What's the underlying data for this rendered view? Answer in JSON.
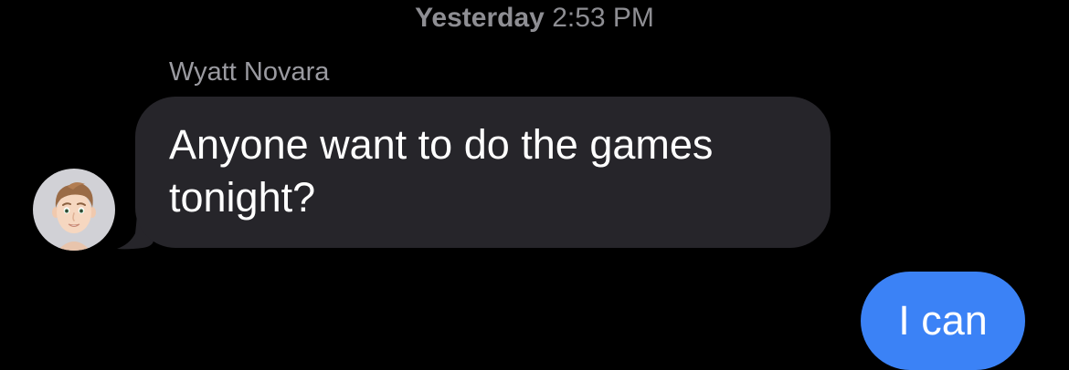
{
  "conversation": {
    "timestamp": {
      "day": "Yesterday",
      "time": "2:53 PM"
    },
    "messages": [
      {
        "direction": "incoming",
        "sender": "Wyatt Novara",
        "avatar_icon": "memoji-avatar-icon",
        "text": "Anyone want to do the games tonight?"
      },
      {
        "direction": "outgoing",
        "text": "I can"
      }
    ]
  },
  "colors": {
    "background": "#000000",
    "incoming_bubble": "#26252a",
    "outgoing_bubble": "#3b82f6",
    "timestamp_text": "#8e8e93",
    "sender_name_text": "#9a9aa0",
    "message_text": "#ffffff"
  }
}
